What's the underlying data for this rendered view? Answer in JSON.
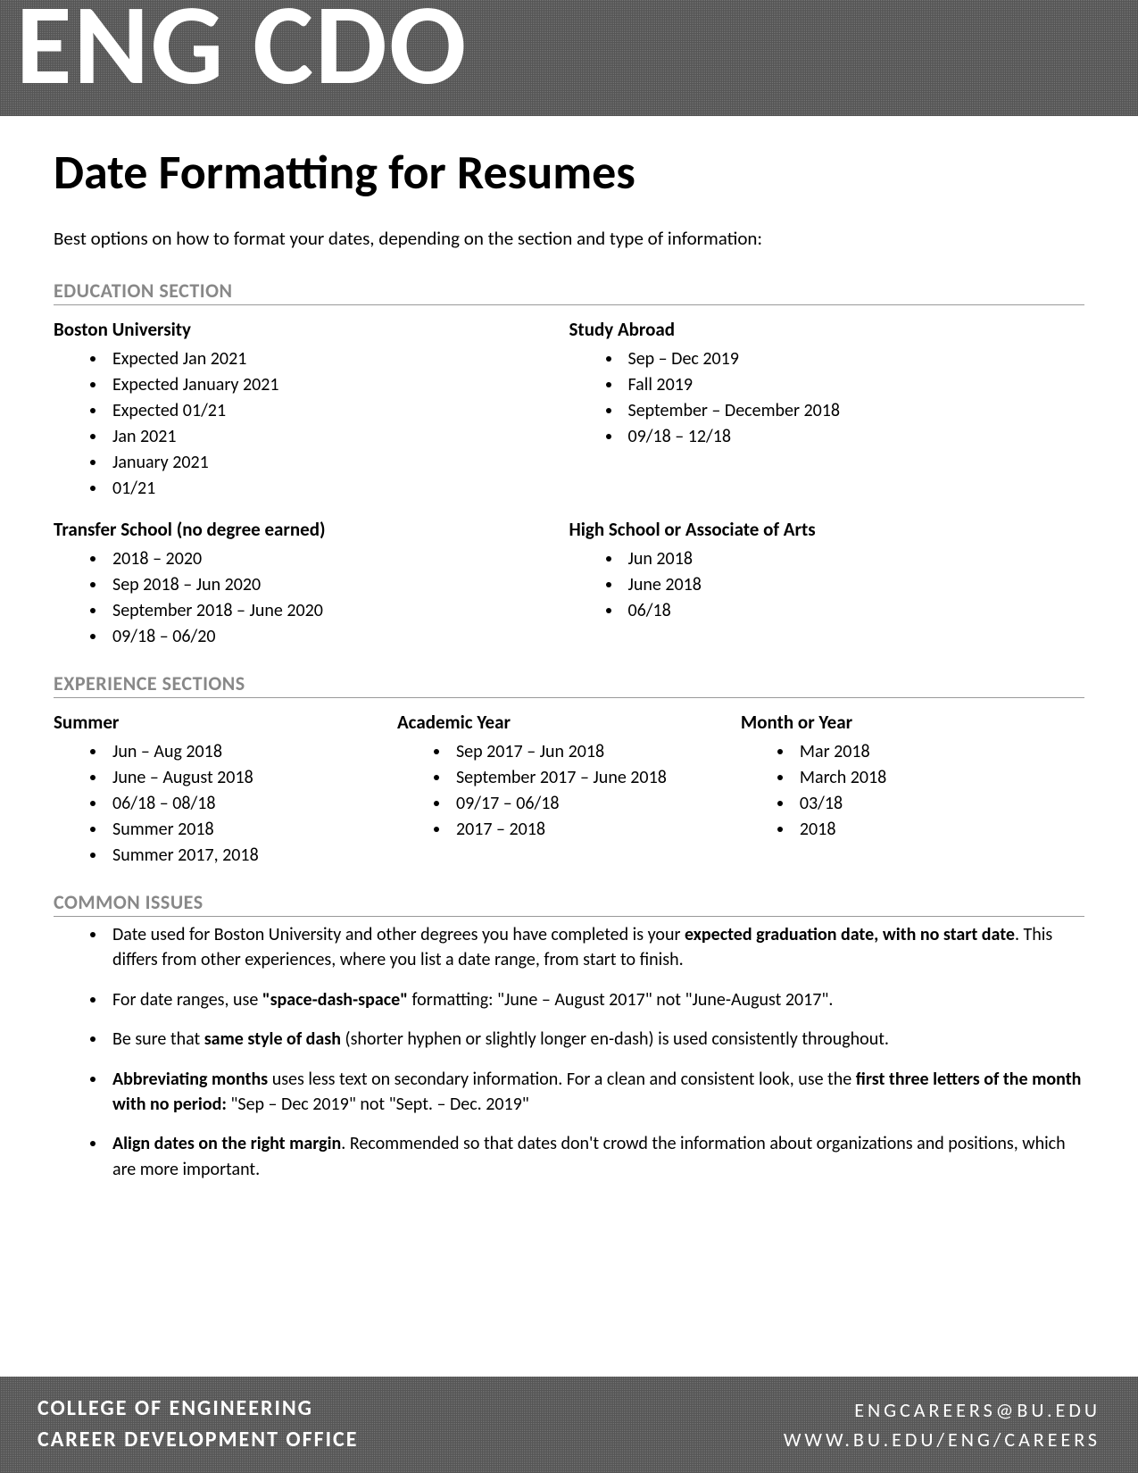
{
  "header": {
    "logo": "ENG CDO"
  },
  "title": "Date Formatting for Resumes",
  "intro": "Best options on how to format your dates, depending on the section and type of information:",
  "education": {
    "heading": "EDUCATION SECTION",
    "bu": {
      "heading": "Boston University",
      "items": [
        "Expected Jan 2021",
        "Expected January 2021",
        "Expected 01/21",
        "Jan 2021",
        "January 2021",
        "01/21"
      ]
    },
    "abroad": {
      "heading": "Study Abroad",
      "items": [
        "Sep – Dec 2019",
        "Fall 2019",
        "September – December 2018",
        "09/18 – 12/18"
      ]
    },
    "transfer": {
      "heading": "Transfer School (no degree earned)",
      "items": [
        "2018 – 2020",
        "Sep 2018 – Jun 2020",
        "September 2018 – June 2020",
        "09/18 – 06/20"
      ]
    },
    "hs": {
      "heading": "High School or Associate of Arts",
      "items": [
        "Jun 2018",
        "June 2018",
        "06/18"
      ]
    }
  },
  "experience": {
    "heading": "EXPERIENCE SECTIONS",
    "summer": {
      "heading": "Summer",
      "items": [
        "Jun – Aug 2018",
        "June – August 2018",
        "06/18 – 08/18",
        "Summer 2018",
        "Summer 2017, 2018"
      ]
    },
    "academic": {
      "heading": "Academic Year",
      "items": [
        "Sep 2017 – Jun 2018",
        "September 2017 – June 2018",
        "09/17 – 06/18",
        "2017 – 2018"
      ]
    },
    "month": {
      "heading": "Month or Year",
      "items": [
        "Mar 2018",
        "March 2018",
        "03/18",
        "2018"
      ]
    }
  },
  "issues": {
    "heading": "COMMON ISSUES",
    "items": [
      {
        "pre": "Date used for Boston University and other degrees you have completed is your ",
        "b1": "expected graduation date, with no start date",
        "post": ". This differs from other experiences, where you list a date range, from start to finish."
      },
      {
        "pre": "For date ranges, use ",
        "b1": "\"space-dash-space\"",
        "post": " formatting: \"June – August 2017\" not \"June-August 2017\"."
      },
      {
        "pre": "Be sure that ",
        "b1": "same style of dash",
        "post": " (shorter hyphen or slightly longer en-dash) is used consistently throughout."
      },
      {
        "b1": "Abbreviating months",
        "mid": " uses less text on secondary information. For a clean and consistent look, use the ",
        "b2": "first three letters of the month with no period:",
        "post": " \"Sep – Dec 2019\" not \"Sept. – Dec. 2019\""
      },
      {
        "b1": "Align dates on the right margin",
        "post": ". Recommended so that dates don't crowd the information about organizations and positions, which are more important."
      }
    ]
  },
  "footer": {
    "left1": "COLLEGE OF ENGINEERING",
    "left2": "CAREER DEVELOPMENT OFFICE",
    "right1": "ENGCAREERS@BU.EDU",
    "right2": "WWW.BU.EDU/ENG/CAREERS"
  }
}
